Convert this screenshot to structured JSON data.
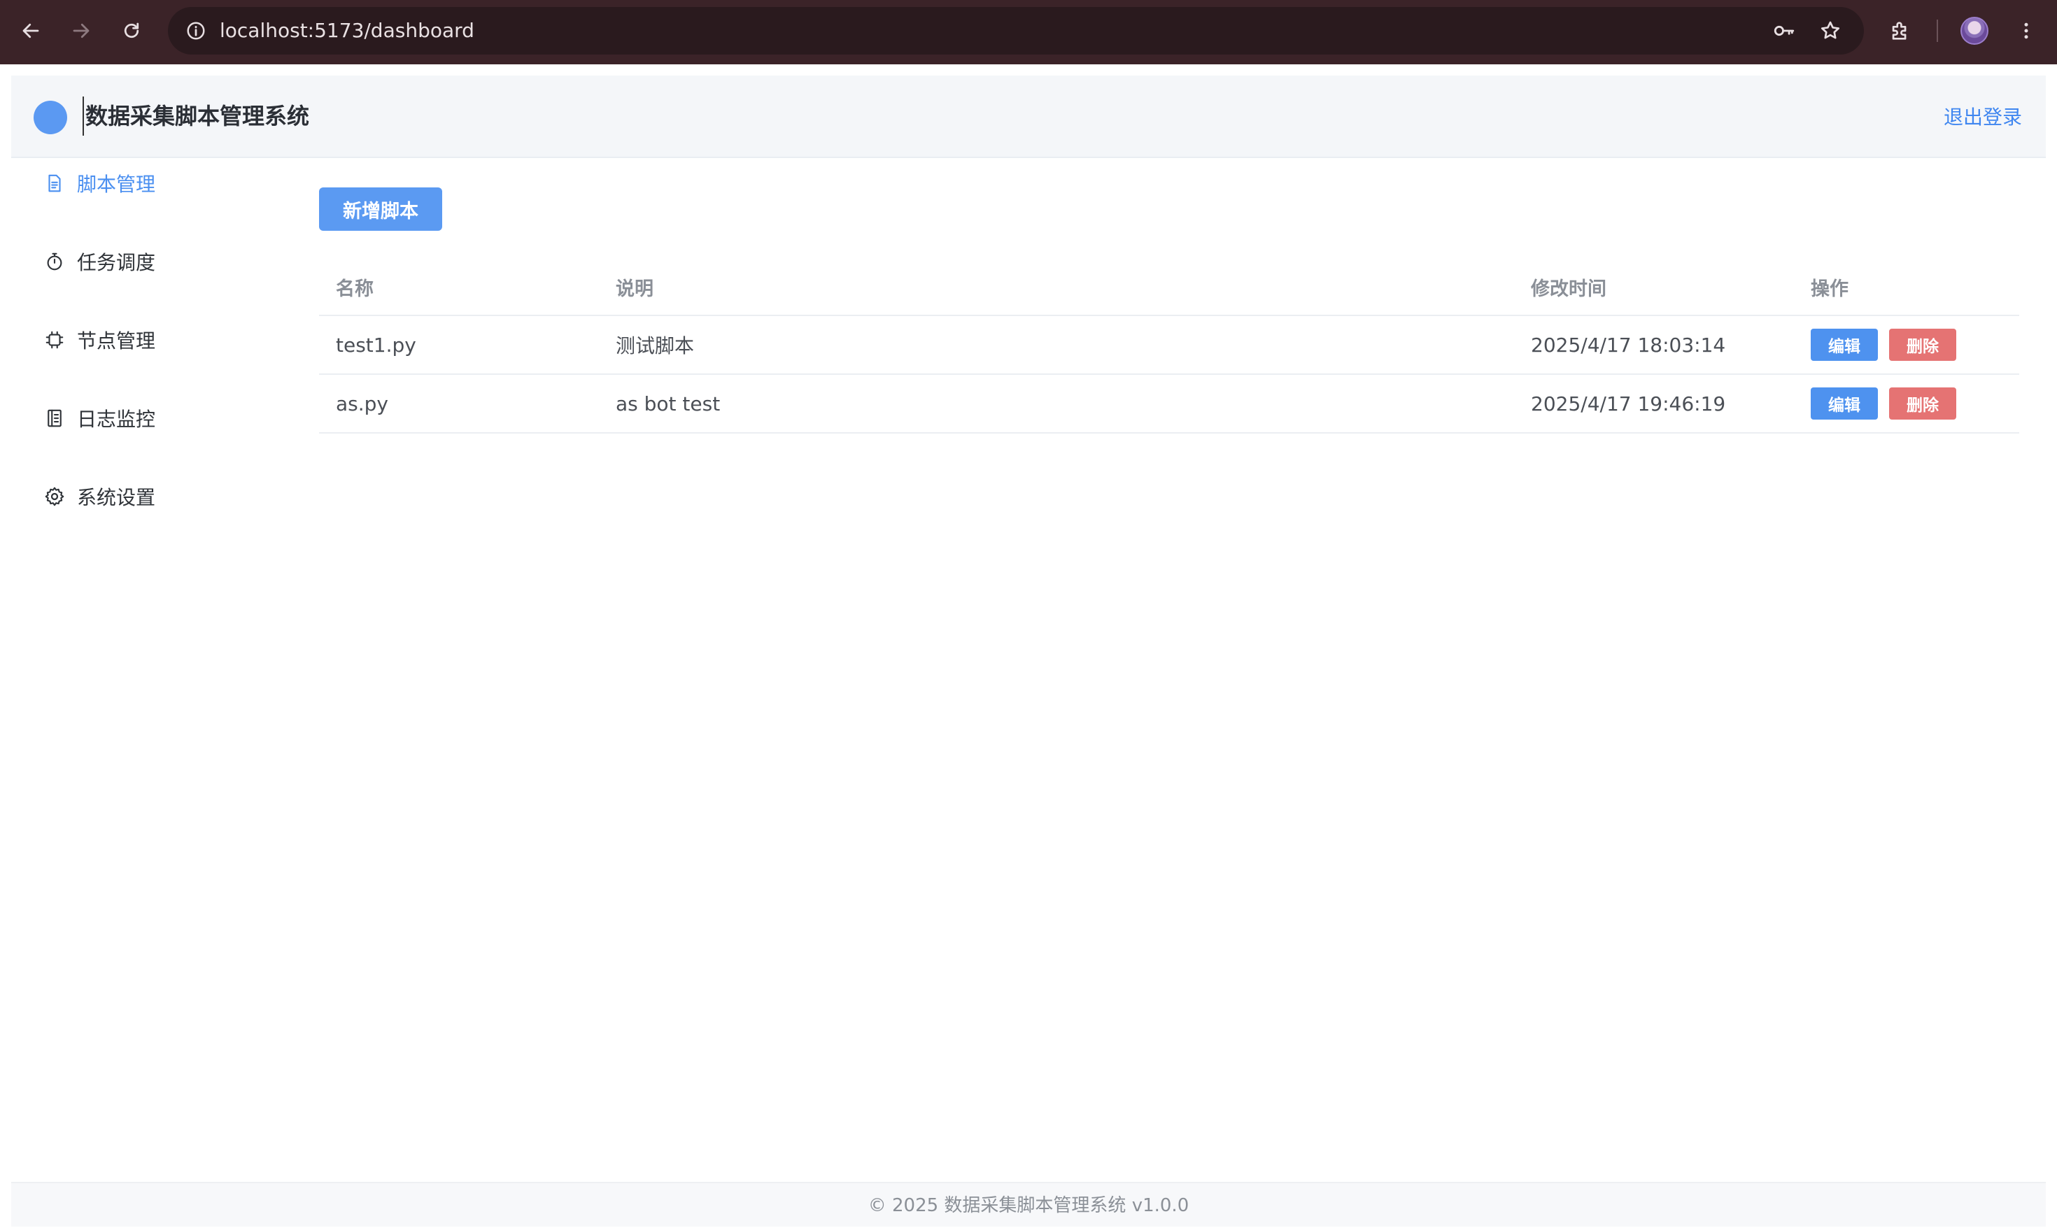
{
  "browser": {
    "url": "localhost:5173/dashboard"
  },
  "header": {
    "title": "数据采集脚本管理系统",
    "logout_label": "退出登录"
  },
  "sidebar": {
    "items": [
      {
        "label": "脚本管理",
        "icon": "document-icon",
        "active": true
      },
      {
        "label": "任务调度",
        "icon": "stopwatch-icon",
        "active": false
      },
      {
        "label": "节点管理",
        "icon": "chip-icon",
        "active": false
      },
      {
        "label": "日志监控",
        "icon": "notebook-icon",
        "active": false
      },
      {
        "label": "系统设置",
        "icon": "gear-icon",
        "active": false
      }
    ]
  },
  "main": {
    "add_button_label": "新增脚本",
    "table": {
      "headers": {
        "name": "名称",
        "desc": "说明",
        "time": "修改时间",
        "ops": "操作"
      },
      "rows": [
        {
          "name": "test1.py",
          "desc": "测试脚本",
          "time": "2025/4/17 18:03:14",
          "edit": "编辑",
          "delete": "删除"
        },
        {
          "name": "as.py",
          "desc": "as bot test",
          "time": "2025/4/17 19:46:19",
          "edit": "编辑",
          "delete": "删除"
        }
      ]
    }
  },
  "footer": {
    "text": "© 2025 数据采集脚本管理系统 v1.0.0"
  },
  "colors": {
    "accent": "#4a8ff0",
    "primary_button": "#5b9af2",
    "danger_button": "#e57373",
    "browser_frame": "#3b2328"
  }
}
